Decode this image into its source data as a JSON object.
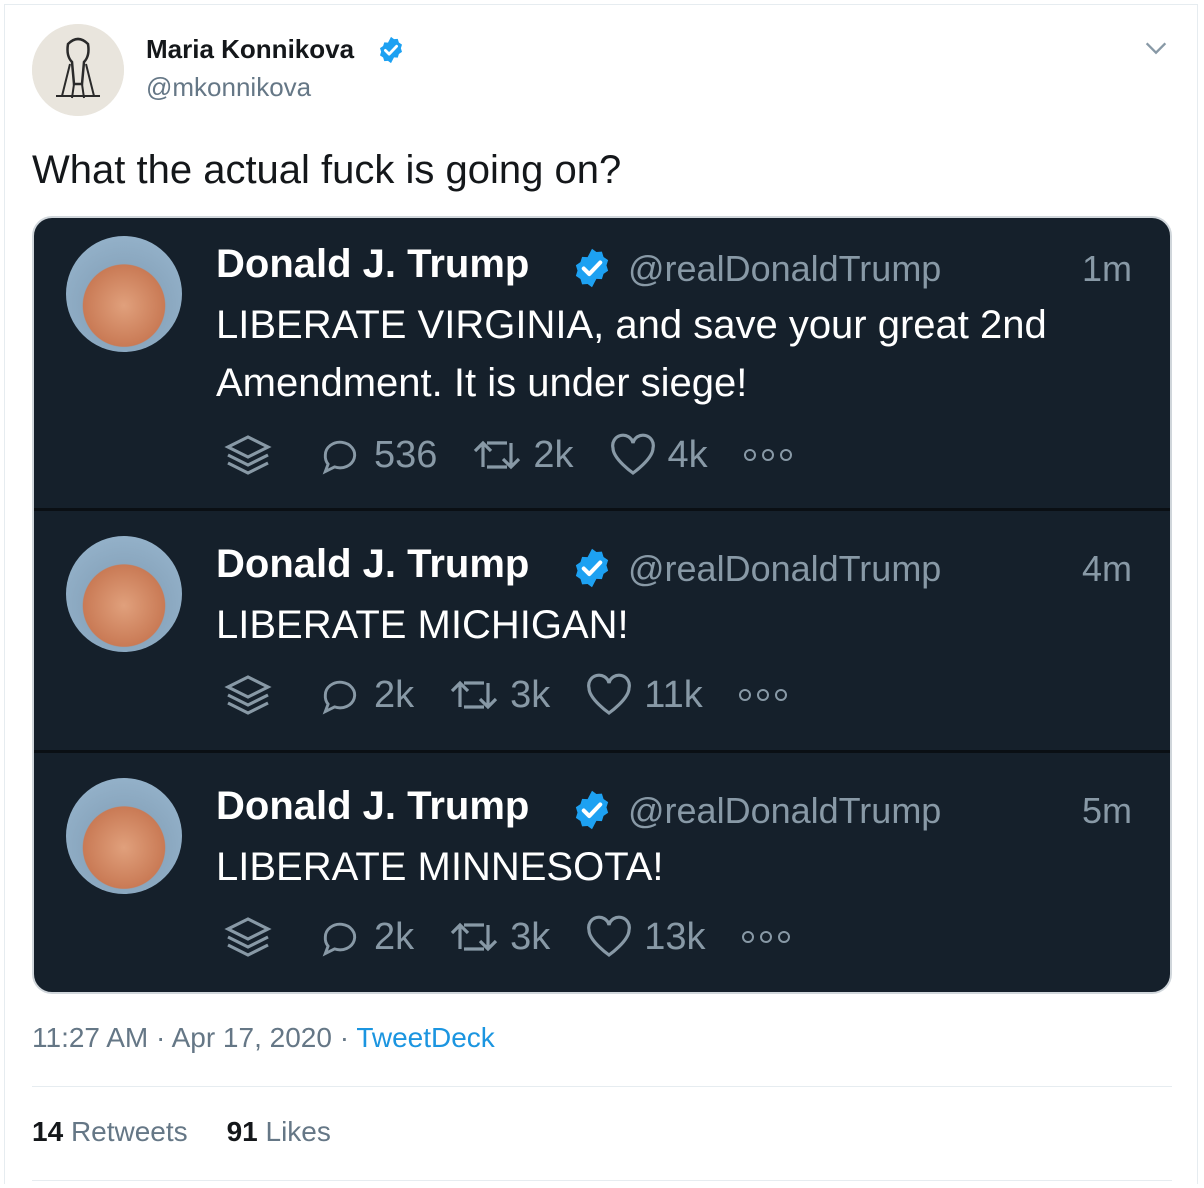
{
  "tweet": {
    "author_name": "Maria Konnikova",
    "author_handle": "@mkonnikova",
    "text": "What the actual fuck is going on?",
    "time": "11:27 AM",
    "date": "Apr 17, 2020",
    "source": "TweetDeck",
    "retweets_count": "14",
    "retweets_label": "Retweets",
    "likes_count": "91",
    "likes_label": "Likes",
    "separator": "·"
  },
  "embedded": [
    {
      "name": "Donald J. Trump",
      "handle": "@realDonaldTrump",
      "time": "1m",
      "line1": "LIBERATE VIRGINIA, and save your great 2nd",
      "line2": "Amendment. It is under siege!",
      "replies": "536",
      "retweets": "2k",
      "likes": "4k"
    },
    {
      "name": "Donald J. Trump",
      "handle": "@realDonaldTrump",
      "time": "4m",
      "line1": "LIBERATE MICHIGAN!",
      "line2": "",
      "replies": "2k",
      "retweets": "3k",
      "likes": "11k"
    },
    {
      "name": "Donald J. Trump",
      "handle": "@realDonaldTrump",
      "time": "5m",
      "line1": "LIBERATE MINNESOTA!",
      "line2": "",
      "replies": "2k",
      "retweets": "3k",
      "likes": "13k"
    }
  ],
  "colors": {
    "verified": "#1da1f2",
    "dark_bg": "#15202b",
    "link": "#1b95e0",
    "muted": "#657786"
  },
  "icons": [
    "verified-badge-icon",
    "chevron-down-icon",
    "layers-icon",
    "reply-icon",
    "retweet-icon",
    "like-icon",
    "more-icon"
  ]
}
